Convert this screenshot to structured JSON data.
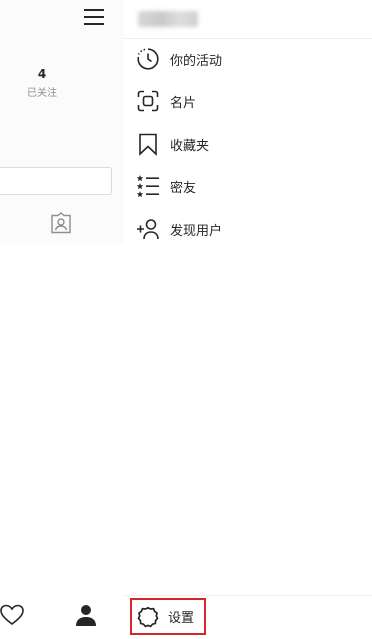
{
  "profile_page": {
    "following_count": "4",
    "following_label": "已关注"
  },
  "drawer": {
    "menu": [
      {
        "label": "你的活动",
        "icon": "activity-icon"
      },
      {
        "label": "名片",
        "icon": "nametag-icon"
      },
      {
        "label": "收藏夹",
        "icon": "bookmark-icon"
      },
      {
        "label": "密友",
        "icon": "close-friends-icon"
      },
      {
        "label": "发现用户",
        "icon": "add-person-icon"
      }
    ],
    "settings_label": "设置"
  },
  "colors": {
    "highlight": "#d4262c",
    "text": "#262626",
    "muted": "#8e8e8e"
  }
}
